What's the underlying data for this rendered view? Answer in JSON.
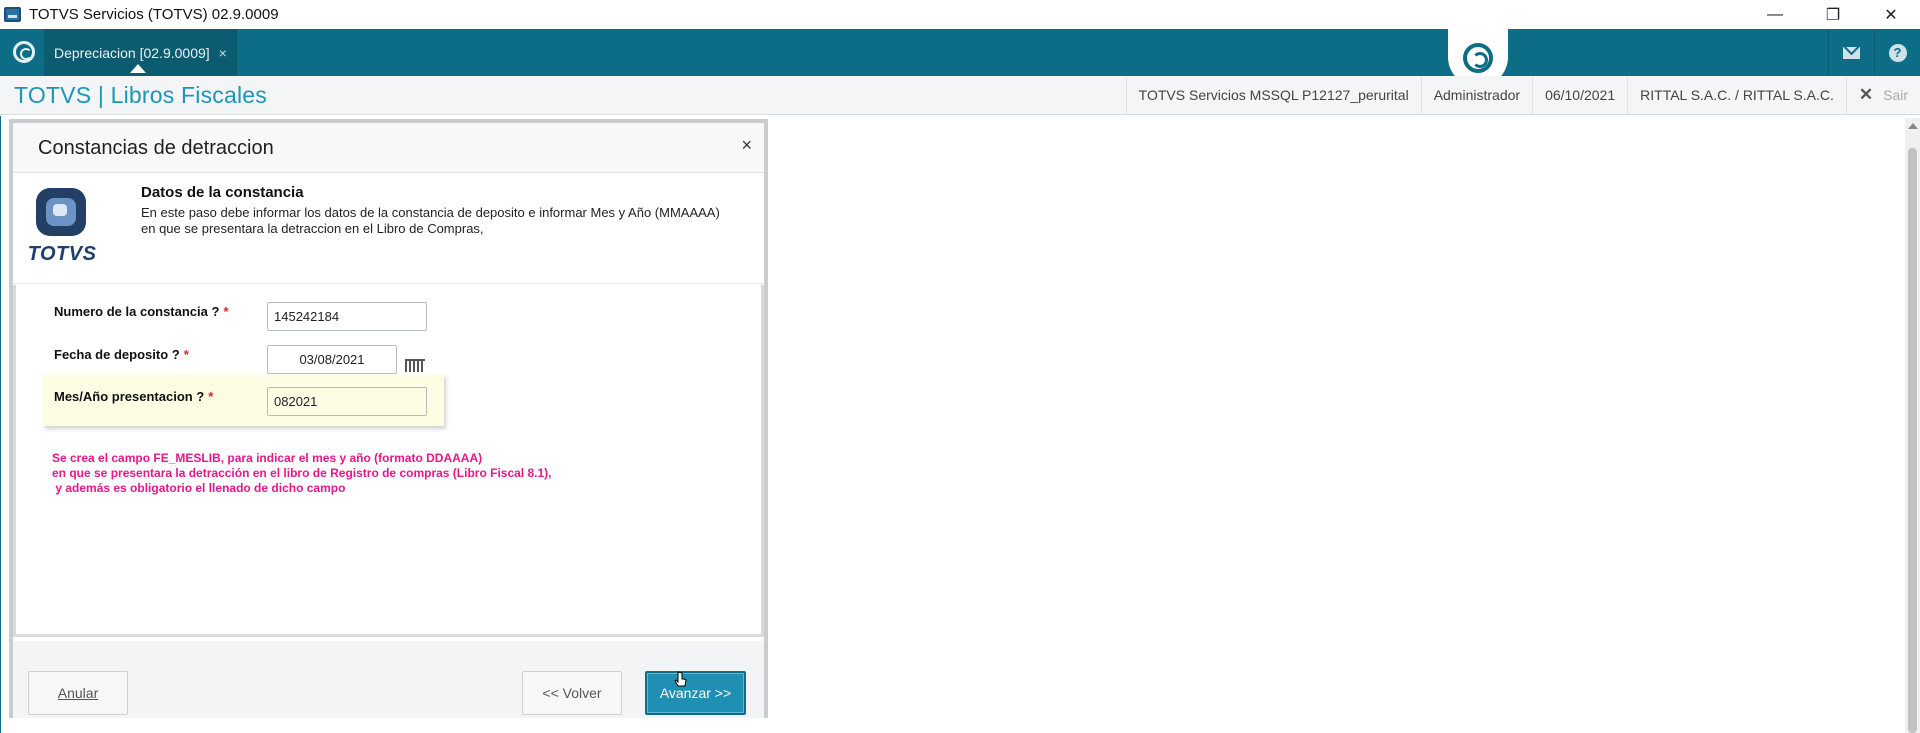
{
  "window": {
    "title": "TOTVS Servicios (TOTVS) 02.9.0009",
    "minimize": "—",
    "restore": "❐",
    "close": "✕"
  },
  "tabbar": {
    "tab_label": "Depreciacion [02.9.0009]",
    "tab_close": "×"
  },
  "header": {
    "app_title": "TOTVS | Libros Fiscales",
    "environment": "TOTVS Servicios MSSQL P12127_perurital",
    "user": "Administrador",
    "date": "06/10/2021",
    "company": "RITTAL S.A.C. / RITTAL S.A.C.",
    "exit_label": "Sair"
  },
  "dialog": {
    "title": "Constancias de detraccion",
    "close": "×",
    "logo_text": "TOTVS",
    "step_title": "Datos de la constancia",
    "step_desc_line1": "En este paso debe informar los datos de la constancia de deposito e informar Mes y Año (MMAAAA)",
    "step_desc_line2": "en que se presentara la detraccion en el Libro de Compras,",
    "fields": {
      "numero_label": "Numero de la constancia ?",
      "numero_value": "145242184",
      "fecha_label": "Fecha de deposito ?",
      "fecha_value": "03/08/2021",
      "mes_label": "Mes/Año presentacion ?",
      "mes_value": "082021",
      "required_mark": "*"
    },
    "note_lines": [
      "Se crea el campo FE_MESLIB, para indicar el mes y año (formato DDAAAA)",
      "en que se presentara la detracción en el libro de Registro de compras (Libro Fiscal 8.1),",
      " y además es obligatorio el llenado de dicho campo"
    ],
    "buttons": {
      "cancel": "Anular",
      "back": "<< Volver",
      "next": "Avanzar >>"
    }
  },
  "colors": {
    "accent": "#0e6d86",
    "title_blue": "#1a97b8",
    "note_pink": "#e6178a",
    "required_red": "#d9242d"
  }
}
